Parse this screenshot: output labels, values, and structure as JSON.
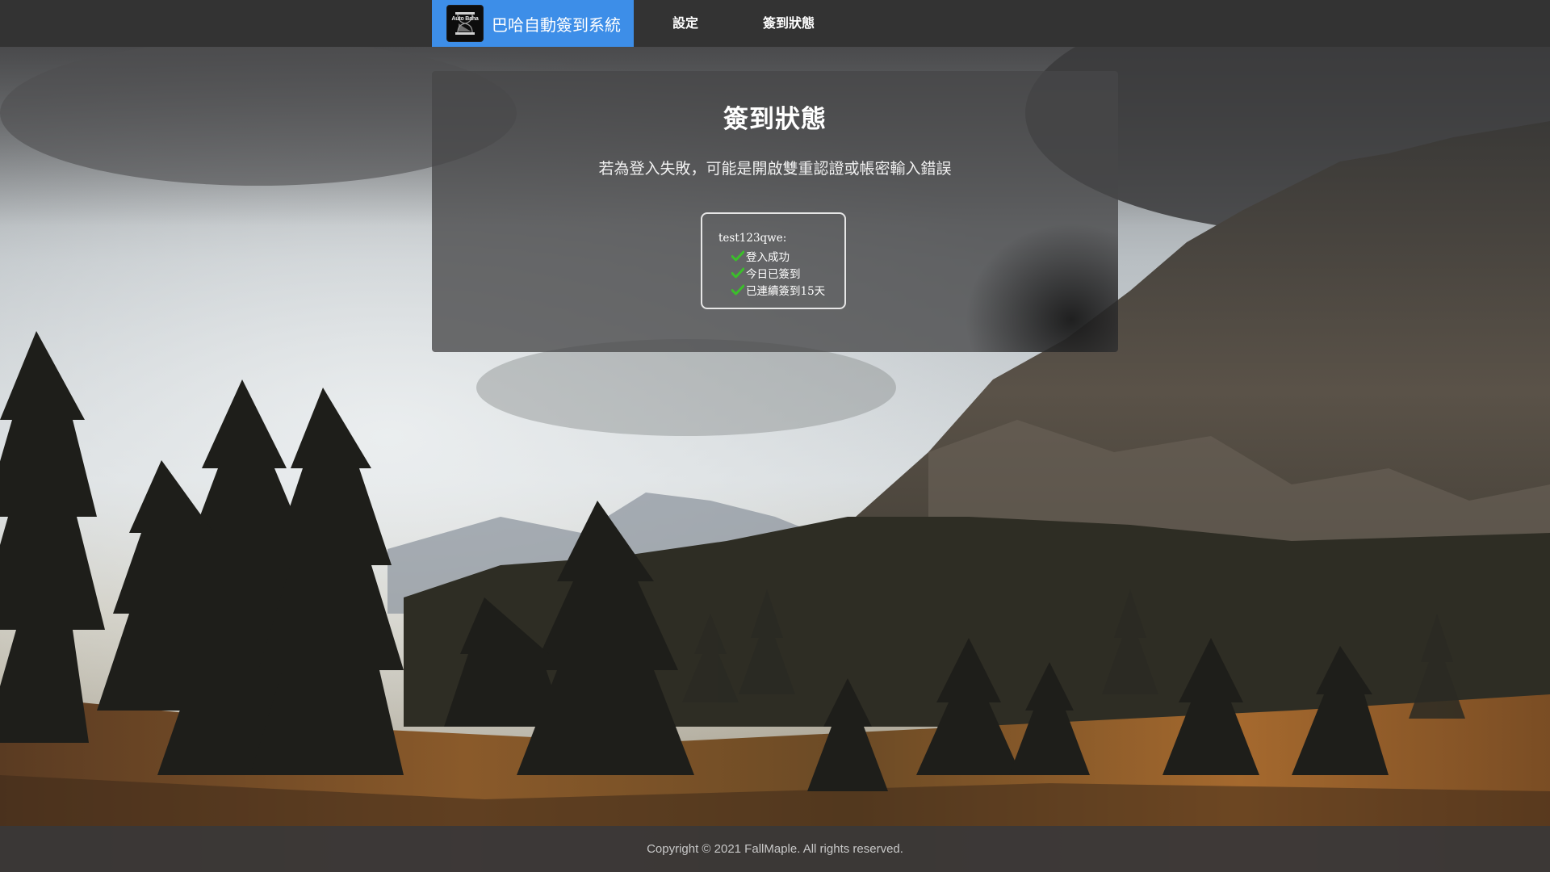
{
  "navbar": {
    "brand_logo_text": "Auto Baha",
    "brand_title": "巴哈自動簽到系統",
    "items": [
      {
        "label": "設定"
      },
      {
        "label": "簽到狀態"
      }
    ],
    "brand_color": "#3d8ee8",
    "bar_color": "#333333"
  },
  "status_card": {
    "title": "簽到狀態",
    "subtitle": "若為登入失敗，可能是開啟雙重認證或帳密輸入錯誤",
    "account": {
      "name": "test123qwe:",
      "statuses": [
        {
          "icon": "check-icon",
          "text": "登入成功"
        },
        {
          "icon": "check-icon",
          "text": "今日已簽到"
        },
        {
          "icon": "check-icon",
          "text": "已連續簽到15天"
        }
      ]
    },
    "check_color": "#3bbf2a"
  },
  "footer": {
    "copyright": "Copyright © 2021 FallMaple. All rights reserved."
  }
}
